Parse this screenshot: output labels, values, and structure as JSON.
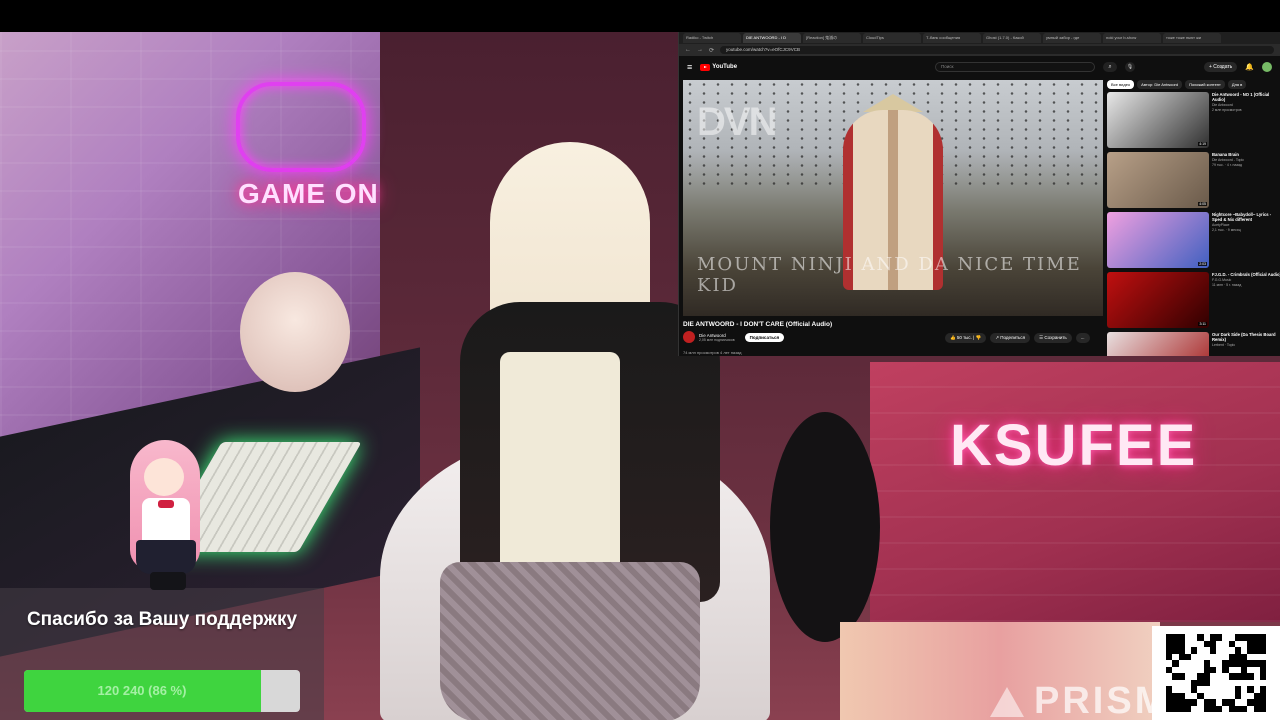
{
  "browser": {
    "tabs": [
      "Radiko - Twitch",
      "DIE ANTWOORD - I D",
      "[Reaction] 鬼滅の",
      "CloudTips",
      "Т-банк сообщения",
      "Ghost (1.7.0) - Какой",
      "умный забор - где",
      "noki your b-show",
      "тоже тоже пьют жи"
    ],
    "active_tab_index": 1,
    "url": "youtube.com/watch?v=eOfCJC9VCB"
  },
  "youtube": {
    "logo": "YouTube",
    "search_placeholder": "Поиск",
    "create_label": "+ Создать",
    "video": {
      "overlay_logo": "DVN",
      "caption": "MOUNT NINJI AND DA NICE TIME KID",
      "title": "DIE ANTWOORD - I DON'T CARE (Official Audio)",
      "channel": "Die Antwoord",
      "subscribers": "2,05 млн подписчиков",
      "subscribe_label": "Подписаться",
      "likes": "50 тыс.",
      "share": "Поделиться",
      "save": "Сохранить",
      "more": "...",
      "description": "74 млн просмотров  4 лет назад"
    },
    "chips": [
      "Все видео",
      "Автор: Die Antwoord",
      "Похожий контент",
      "Для в"
    ],
    "active_chip_index": 0,
    "related": [
      {
        "title": "Die Antwoord - NO 1 (Official Audio)",
        "channel": "Die Antwoord",
        "stats": "2 млн просмотров",
        "duration": "4:19",
        "colors": [
          "#e8e8e8",
          "#303030"
        ]
      },
      {
        "title": "Banana Brain",
        "channel": "Die Antwoord - Topic",
        "stats": "79 тыс. · 4 г. назад",
        "duration": "4:05",
        "colors": [
          "#b8a088",
          "#6a5a4a"
        ]
      },
      {
        "title": "Nightcore ~Babydoll~ Lyrics - Sped & Nix different",
        "channel": "AcetyPlace",
        "stats": "2,1 тыс. · 9 месяц",
        "duration": "2:03",
        "colors": [
          "#f0a0e0",
          "#4060c0"
        ]
      },
      {
        "title": "FJ.G.D. - Crimbrals (Official Audio)",
        "channel": "F.G.G.Music",
        "stats": "11 млн · 5 г. назад",
        "duration": "3:11",
        "colors": [
          "#c01010",
          "#300000"
        ]
      },
      {
        "title": "Our Dark Side (Da Thesis Board Remix)",
        "channel": "Lerbent · Topic",
        "stats": "",
        "duration": "",
        "colors": [
          "#e8e0e0",
          "#a01010"
        ]
      }
    ]
  },
  "stream": {
    "neon_left": "GAME ON",
    "neon_right": "KSUFEE",
    "donation": {
      "message": "Спасибо за Вашу поддержку",
      "progress_text": "120 240 (86 %)",
      "progress_fraction": 0.86
    },
    "watermark": "PRISM"
  },
  "colors": {
    "progress_fill": "#3fd43f",
    "youtube_red": "#ff0000"
  }
}
